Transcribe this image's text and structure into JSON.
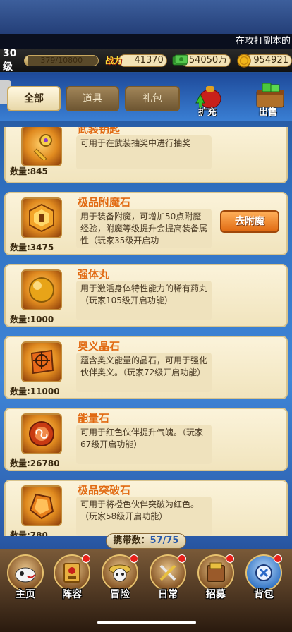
{
  "ticker": {
    "text": "在攻打副本的"
  },
  "stats": {
    "level": "30级",
    "exp_text": "379/10800",
    "exp_progress": 0.035,
    "power_label": "战力",
    "power": "41370",
    "cash": "54050万",
    "gold": "954921"
  },
  "tabs": [
    {
      "label": "全部",
      "active": true
    },
    {
      "label": "道具",
      "active": false
    },
    {
      "label": "礼包",
      "active": false
    }
  ],
  "top_buttons": {
    "expand": "扩充",
    "sell": "出售"
  },
  "items": [
    {
      "name": "武装钥匙",
      "desc": "可用于在武装抽奖中进行抽奖",
      "qty": "数量:845",
      "icon": "key-icon"
    },
    {
      "name": "极品附魔石",
      "desc": "用于装备附魔，可增加50点附魔经验，附魔等级提升会提高装备属性（玩家35级开启功",
      "qty": "数量:3475",
      "icon": "enchant-stone-icon",
      "action": "去附魔"
    },
    {
      "name": "强体丸",
      "desc": "用于激活身体特性能力的稀有药丸（玩家105级开启功能）",
      "qty": "数量:1000",
      "icon": "pill-icon"
    },
    {
      "name": "奥义晶石",
      "desc": "蕴含奥义能量的晶石，可用于强化伙伴奥义。（玩家72级开启功能）",
      "qty": "数量:11000",
      "icon": "crystal-icon"
    },
    {
      "name": "能量石",
      "desc": "可用于红色伙伴提升气魄。（玩家67级开启功能）",
      "qty": "数量:26780",
      "icon": "energy-stone-icon"
    },
    {
      "name": "极品突破石",
      "desc": "可用于将橙色伙伴突破为红色。（玩家58级开启功能）",
      "qty": "数量:780",
      "icon": "breakthrough-stone-icon"
    }
  ],
  "carry": {
    "label": "携带数：",
    "value": "57/75"
  },
  "nav": [
    {
      "label": "主页",
      "icon": "home-icon",
      "dot": false
    },
    {
      "label": "阵容",
      "icon": "lineup-icon",
      "dot": true
    },
    {
      "label": "冒险",
      "icon": "adventure-icon",
      "dot": true
    },
    {
      "label": "日常",
      "icon": "daily-icon",
      "dot": true
    },
    {
      "label": "招募",
      "icon": "recruit-icon",
      "dot": true
    },
    {
      "label": "背包",
      "icon": "bag-icon",
      "dot": true
    }
  ]
}
